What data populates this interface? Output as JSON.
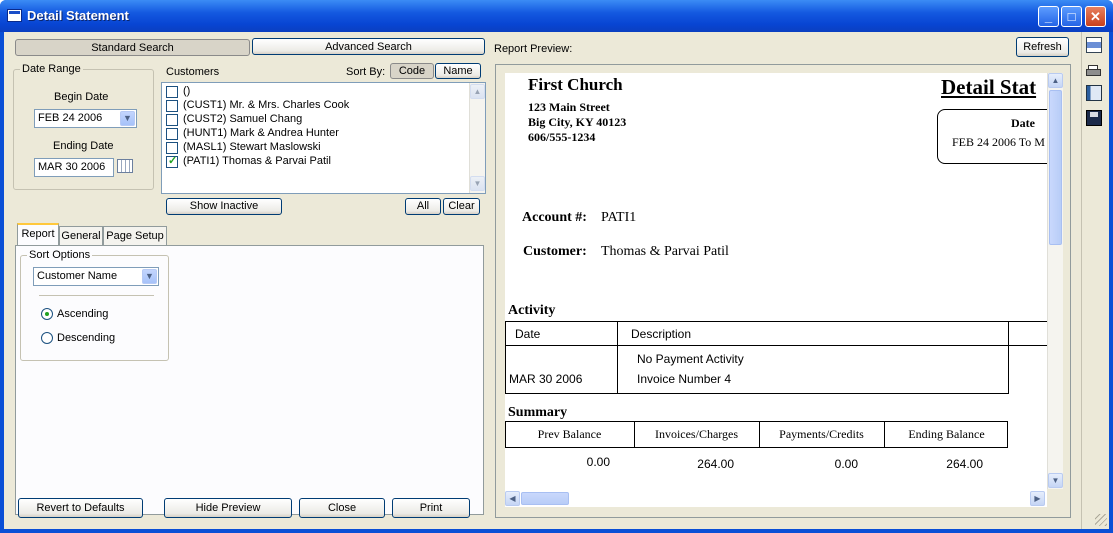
{
  "window": {
    "title": "Detail Statement",
    "minimize": "_",
    "maximize": "□",
    "close": "✕"
  },
  "search": {
    "standard_label": "Standard Search",
    "advanced_label": "Advanced Search"
  },
  "date_range": {
    "group_label": "Date Range",
    "begin_label": "Begin Date",
    "begin_value": "FEB 24 2006",
    "end_label": "Ending Date",
    "end_value": "MAR 30 2006"
  },
  "customers": {
    "label": "Customers",
    "sort_by_label": "Sort By:",
    "sort_code": "Code",
    "sort_name": "Name",
    "items": [
      {
        "text": "()",
        "checked": false
      },
      {
        "text": "(CUST1) Mr. & Mrs. Charles Cook",
        "checked": false
      },
      {
        "text": "(CUST2) Samuel Chang",
        "checked": false
      },
      {
        "text": "(HUNT1) Mark & Andrea Hunter",
        "checked": false
      },
      {
        "text": "(MASL1) Stewart Maslowski",
        "checked": false
      },
      {
        "text": "(PATI1) Thomas & Parvai Patil",
        "checked": true
      }
    ],
    "show_inactive": "Show Inactive",
    "all": "All",
    "clear": "Clear"
  },
  "tabs": {
    "report": "Report",
    "general": "General",
    "page_setup": "Page Setup"
  },
  "sort_options": {
    "group_label": "Sort Options",
    "field_value": "Customer Name",
    "ascending": "Ascending",
    "descending": "Descending",
    "selected": "ascending"
  },
  "footer": {
    "revert": "Revert to Defaults",
    "hide_preview": "Hide Preview",
    "close": "Close",
    "print": "Print"
  },
  "preview": {
    "label": "Report Preview:",
    "refresh": "Refresh",
    "org_name": "First Church",
    "address1": "123 Main Street",
    "address2": "Big City, KY  40123",
    "phone": "606/555-1234",
    "report_title": "Detail Stat",
    "date_header": "Date",
    "date_range": "FEB 24 2006 To M",
    "account_label": "Account #:",
    "account_value": "PATI1",
    "customer_label": "Customer:",
    "customer_value": "Thomas & Parvai Patil",
    "activity_heading": "Activity",
    "activity_cols": {
      "date": "Date",
      "description": "Description"
    },
    "activity_rows": [
      {
        "date": "",
        "description": "No Payment Activity"
      },
      {
        "date": "MAR 30 2006",
        "description": "Invoice Number 4"
      }
    ],
    "summary_heading": "Summary",
    "summary_cols": {
      "prev": "Prev Balance",
      "invoices": "Invoices/Charges",
      "payments": "Payments/Credits",
      "ending": "Ending Balance"
    },
    "summary_values": {
      "prev": "0.00",
      "invoices": "264.00",
      "payments": "0.00",
      "ending": "264.00"
    }
  },
  "side_toolbar": [
    "printer-setup-icon",
    "printer-icon",
    "export-icon",
    "save-icon"
  ]
}
